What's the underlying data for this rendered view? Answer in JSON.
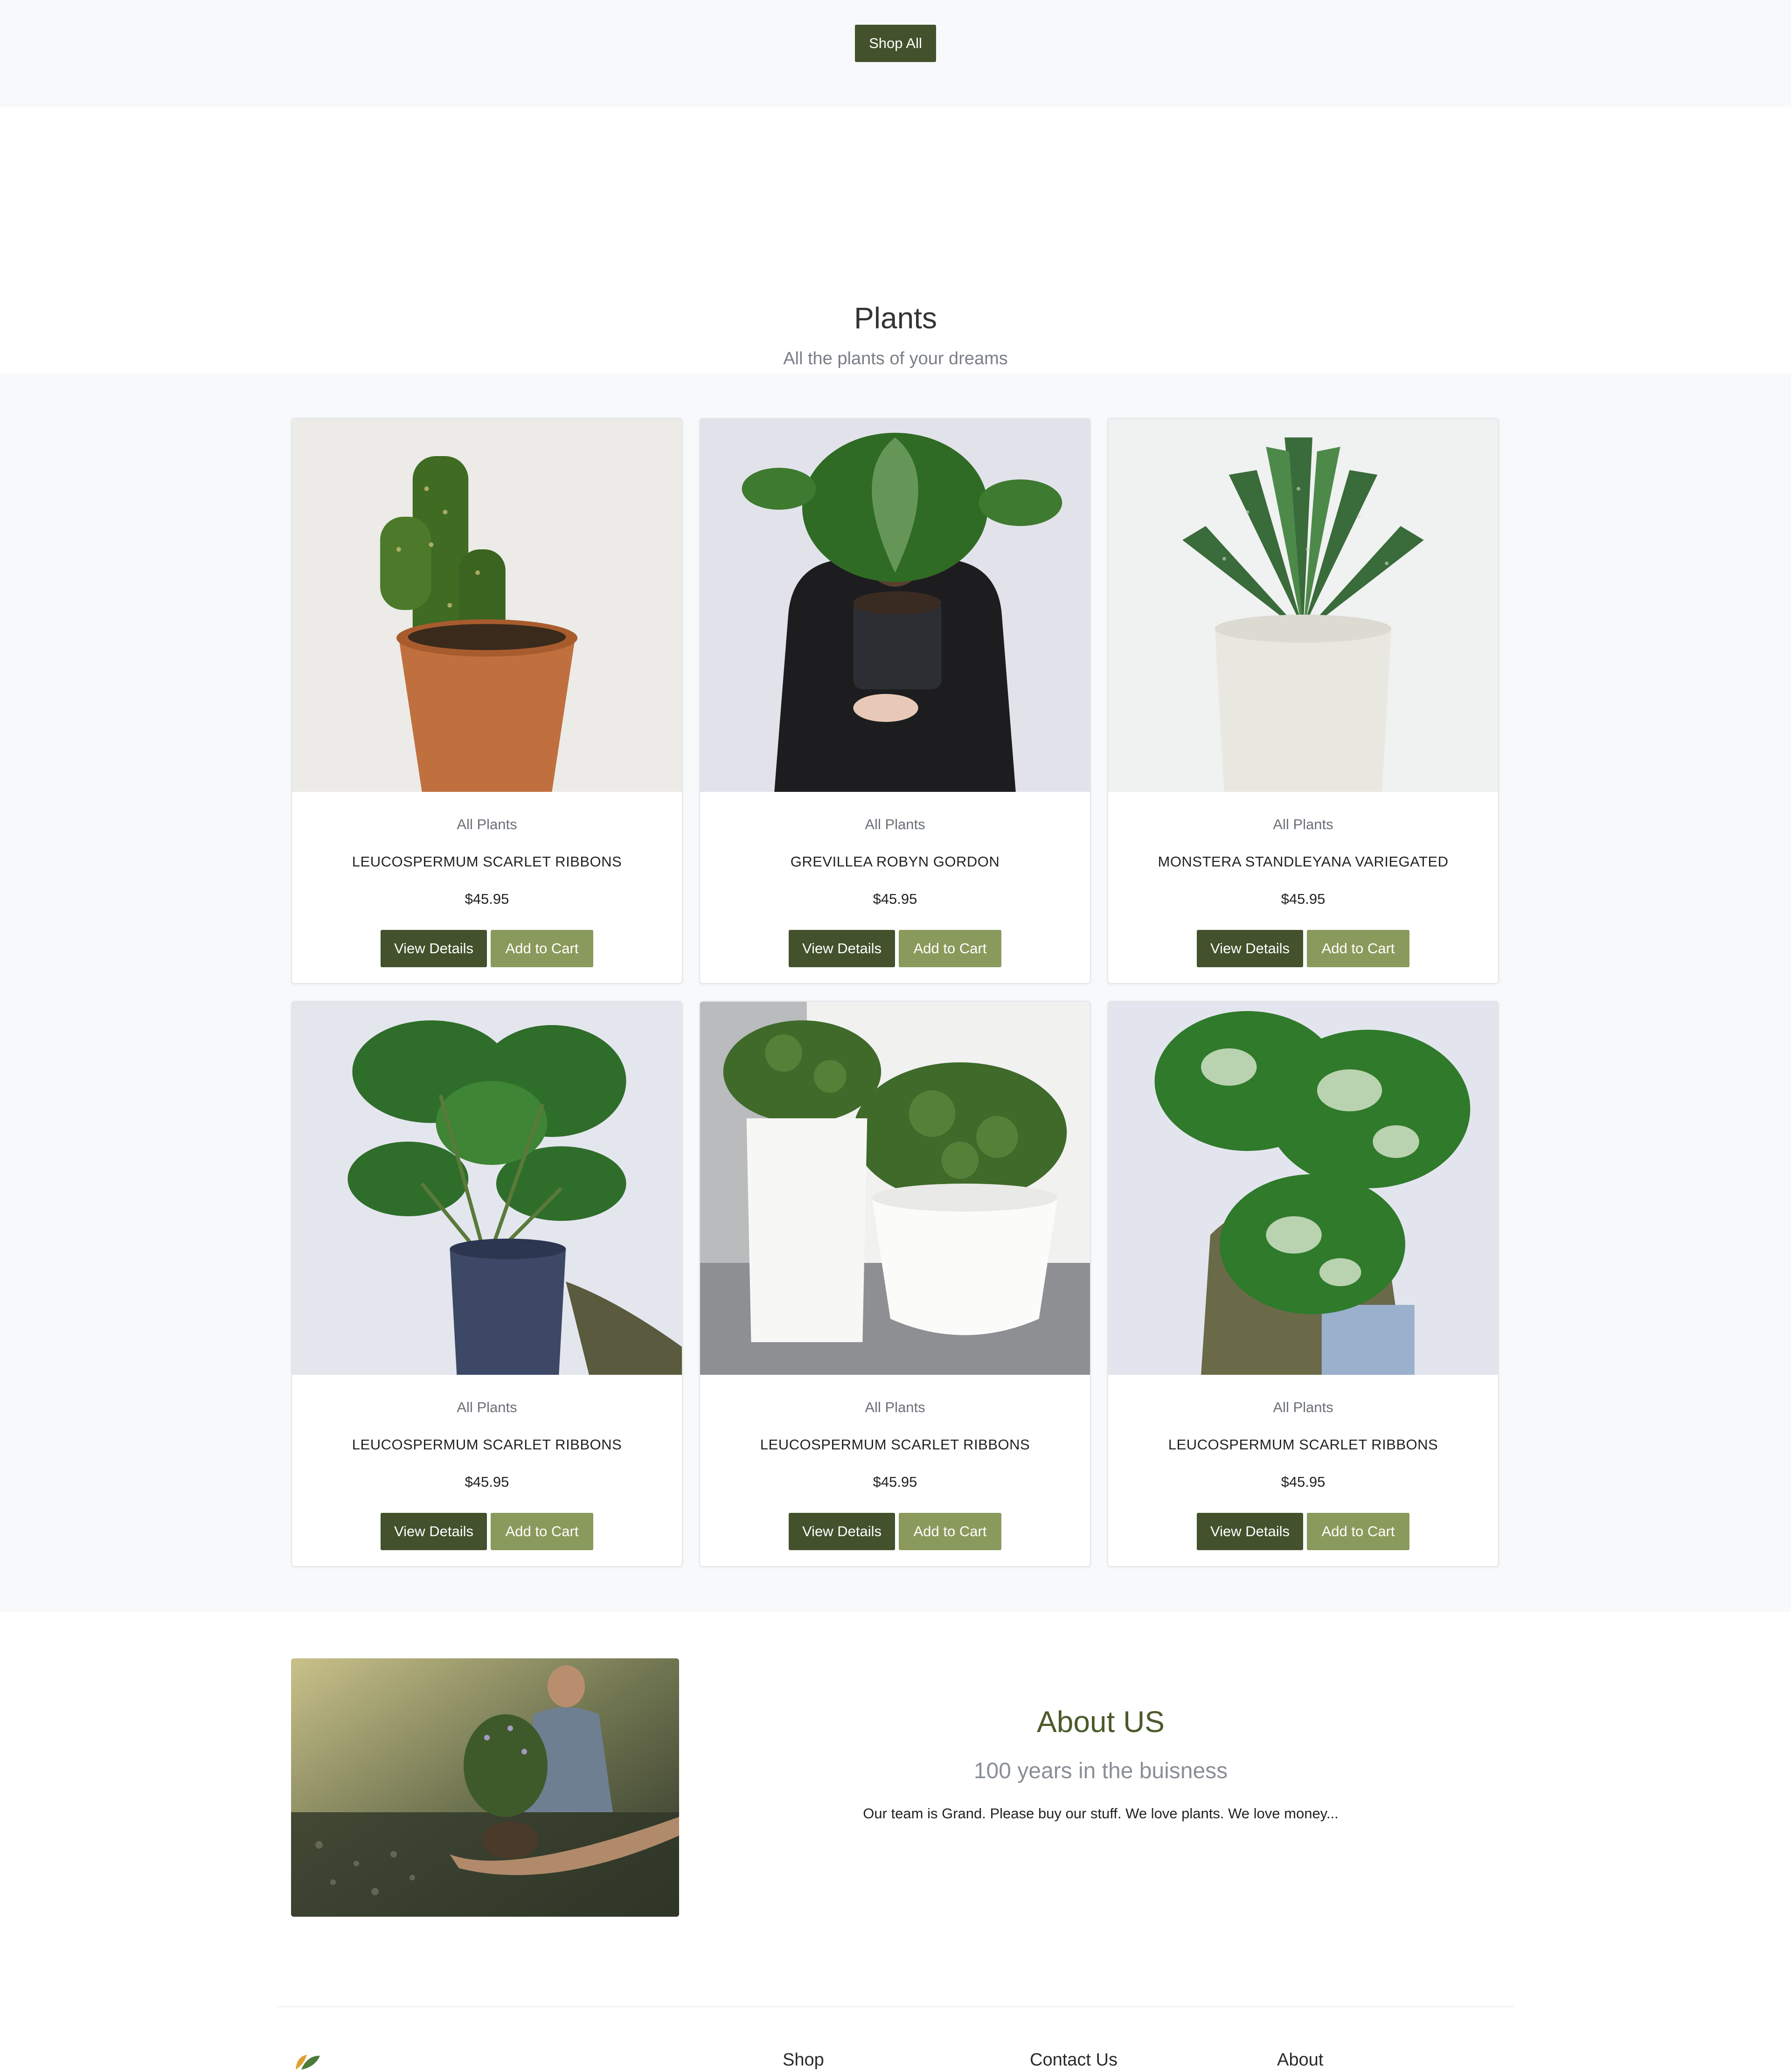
{
  "hero": {
    "shop_all_label": "Shop All"
  },
  "plants_section": {
    "title": "Plants",
    "subtitle": "All the plants of your dreams"
  },
  "products": [
    {
      "category": "All Plants",
      "name": "LEUCOSPERMUM SCARLET RIBBONS",
      "price": "$45.95",
      "view_label": "View Details",
      "cart_label": "Add to Cart",
      "image_icon": "cactus-photo"
    },
    {
      "category": "All Plants",
      "name": "GREVILLEA ROBYN GORDON",
      "price": "$45.95",
      "view_label": "View Details",
      "cart_label": "Add to Cart",
      "image_icon": "monstera-person-photo"
    },
    {
      "category": "All Plants",
      "name": "MONSTERA STANDLEYANA VARIEGATED",
      "price": "$45.95",
      "view_label": "View Details",
      "cart_label": "Add to Cart",
      "image_icon": "aloe-photo"
    },
    {
      "category": "All Plants",
      "name": "LEUCOSPERMUM SCARLET RIBBONS",
      "price": "$45.95",
      "view_label": "View Details",
      "cart_label": "Add to Cart",
      "image_icon": "monstera-pot-photo"
    },
    {
      "category": "All Plants",
      "name": "LEUCOSPERMUM SCARLET RIBBONS",
      "price": "$45.95",
      "view_label": "View Details",
      "cart_label": "Add to Cart",
      "image_icon": "succulent-pots-photo"
    },
    {
      "category": "All Plants",
      "name": "LEUCOSPERMUM SCARLET RIBBONS",
      "price": "$45.95",
      "view_label": "View Details",
      "cart_label": "Add to Cart",
      "image_icon": "variegated-monstera-photo"
    }
  ],
  "about": {
    "title": "About US",
    "subtitle": "100 years in the buisness",
    "text": "Our team is Grand. Please buy our stuff. We love plants. We love money...",
    "image_icon": "gardener-photo"
  },
  "footer": {
    "columns": [
      "Shop",
      "Contact Us",
      "About"
    ],
    "logo_icon": "leaf-logo"
  },
  "colors": {
    "primary": "#43512c",
    "secondary": "#8a9a5c",
    "band_bg": "#f7f9fb"
  }
}
